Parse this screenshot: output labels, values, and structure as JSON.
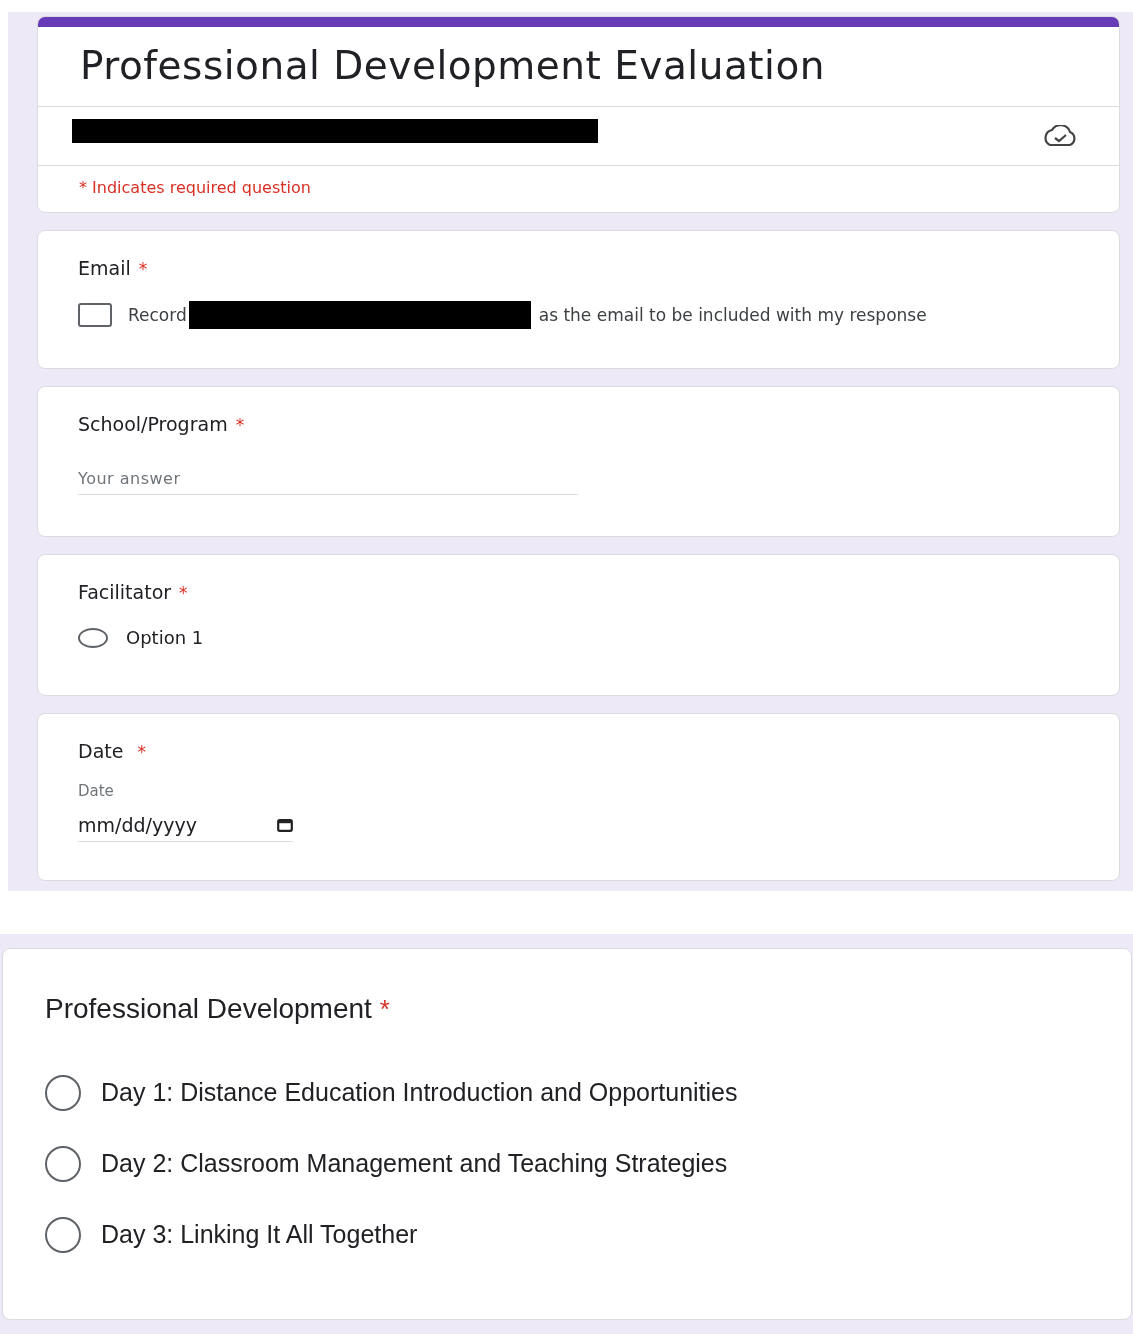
{
  "form": {
    "title": "Professional Development Evaluation",
    "required_note": "* Indicates required question"
  },
  "questions": [
    {
      "kind": "email",
      "label": "Email",
      "mark": "*",
      "checkbox_before": "Record",
      "checkbox_after": "as the email to be included with my response",
      "checked": false
    },
    {
      "kind": "text",
      "label": "School/Program",
      "mark": "*",
      "placeholder": "Your answer"
    },
    {
      "kind": "radio",
      "label": "Facilitator",
      "mark": "*",
      "options": [
        {
          "label": "Option 1",
          "selected": false
        }
      ]
    },
    {
      "kind": "date",
      "label": "Date",
      "mark": "*",
      "field_label": "Date",
      "placeholder": "mm/dd/yyyy"
    }
  ],
  "section": {
    "label": "Professional Development",
    "mark": "*",
    "options": [
      {
        "label": "Day 1: Distance Education Introduction and Opportunities",
        "selected": false
      },
      {
        "label": "Day 2: Classroom Management and Teaching Strategies",
        "selected": false
      },
      {
        "label": "Day 3: Linking It All Together",
        "selected": false
      }
    ]
  }
}
